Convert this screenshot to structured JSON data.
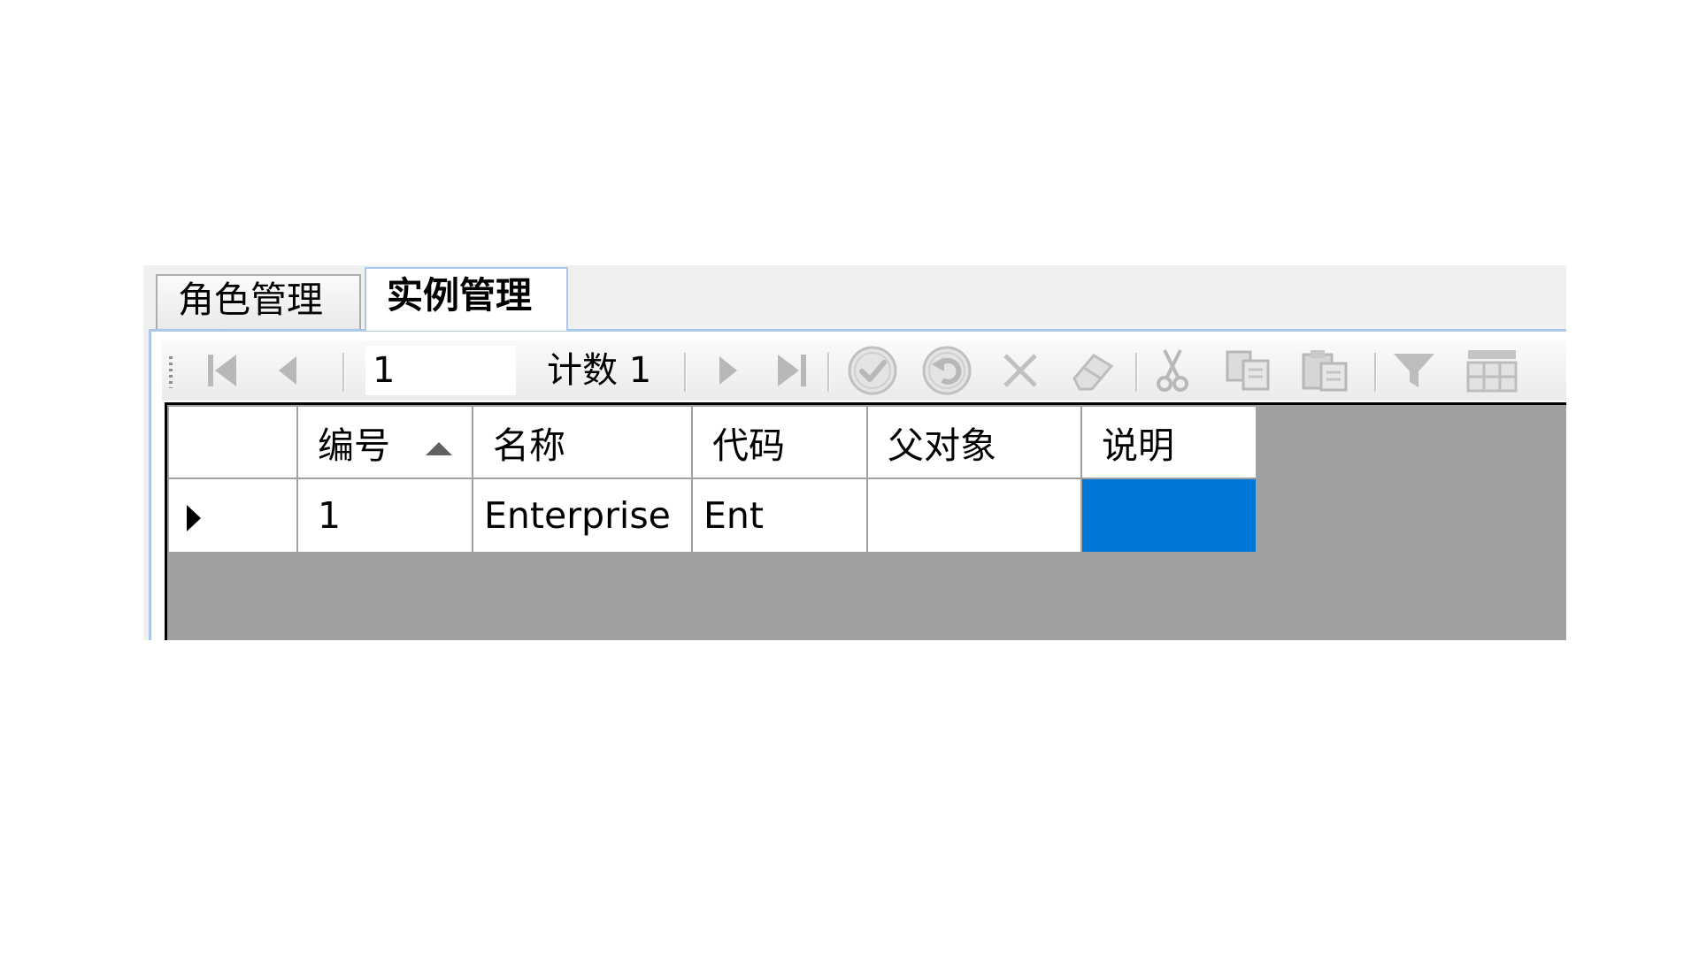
{
  "tabs": [
    {
      "label": "角色管理",
      "active": false
    },
    {
      "label": "实例管理",
      "active": true
    }
  ],
  "navigator": {
    "position": "1",
    "count_label": "计数 1",
    "buttons": [
      "first-record-icon",
      "previous-record-icon",
      "next-record-icon",
      "last-record-icon",
      "end-edit-icon",
      "cancel-edit-icon",
      "delete-icon",
      "eraser-icon",
      "cut-icon",
      "copy-icon",
      "paste-icon",
      "filter-icon",
      "column-chooser-icon"
    ]
  },
  "grid": {
    "columns": [
      "编号",
      "名称",
      "代码",
      "父对象",
      "说明"
    ],
    "sorted_column": "编号",
    "sort_direction": "ascending",
    "rows": [
      {
        "id": "1",
        "name": "Enterprise",
        "code": "Ent",
        "parent": "",
        "description": ""
      }
    ]
  },
  "colors": {
    "selected_cell": "#0078d7",
    "empty_area": "#a0a0a0",
    "tab_border": "#a9c8ea"
  }
}
